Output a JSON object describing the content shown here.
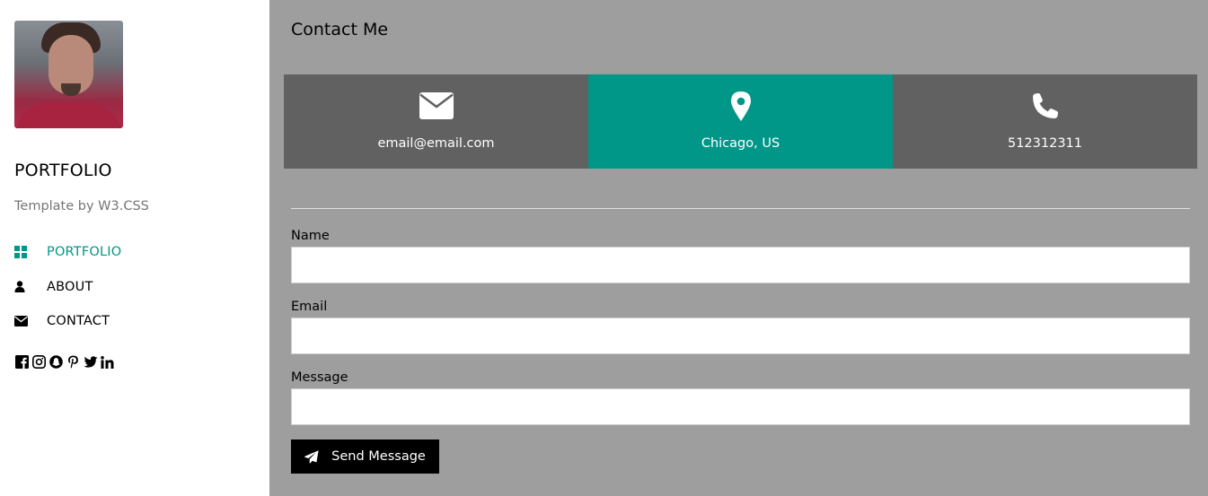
{
  "sidebar": {
    "brand": "PORTFOLIO",
    "tagline": "Template by W3.CSS",
    "nav": [
      {
        "label": "PORTFOLIO",
        "icon": "grid-icon",
        "active": true
      },
      {
        "label": "ABOUT",
        "icon": "user-icon",
        "active": false
      },
      {
        "label": "CONTACT",
        "icon": "envelope-icon",
        "active": false
      }
    ],
    "social": [
      "facebook-icon",
      "instagram-icon",
      "snapchat-icon",
      "pinterest-icon",
      "twitter-icon",
      "linkedin-icon"
    ]
  },
  "main": {
    "title": "Contact Me",
    "info": [
      {
        "text": "email@email.com",
        "icon": "envelope-icon"
      },
      {
        "text": "Chicago, US",
        "icon": "map-marker-icon"
      },
      {
        "text": "512312311",
        "icon": "phone-icon"
      }
    ],
    "form": {
      "name_label": "Name",
      "name_value": "",
      "email_label": "Email",
      "email_value": "",
      "message_label": "Message",
      "message_value": "",
      "send_label": "Send Message"
    }
  },
  "colors": {
    "accent": "#009688",
    "main_bg": "#9e9e9e",
    "info_bg": "#616161",
    "button_bg": "#000000"
  }
}
